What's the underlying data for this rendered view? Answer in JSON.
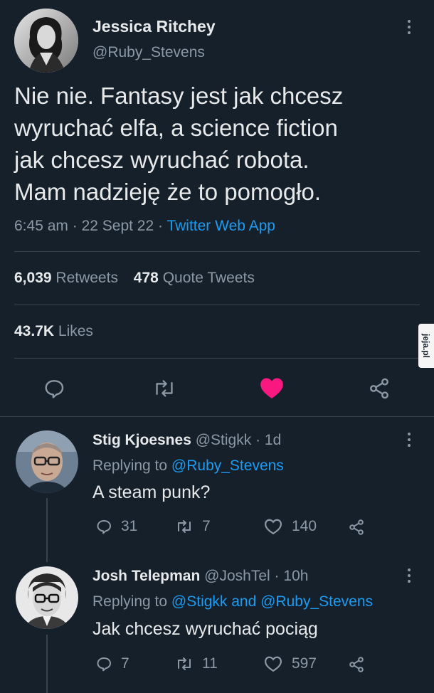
{
  "tweet": {
    "author_name": "Jessica Ritchey",
    "author_handle": "@Ruby_Stevens",
    "text_lines": [
      "Nie nie. Fantasy jest jak chcesz",
      "wyruchać elfa, a science fiction",
      "jak chcesz wyruchać robota.",
      "Mam nadzieję że to pomogło."
    ],
    "time": "6:45 am",
    "date": "22 Sept 22",
    "source": "Twitter Web App",
    "retweets_count": "6,039",
    "retweets_label": "Retweets",
    "quotes_count": "478",
    "quotes_label": "Quote Tweets",
    "likes_count": "43.7K",
    "likes_label": "Likes"
  },
  "replies": [
    {
      "name": "Stig Kjoesnes",
      "handle": "@Stigkk",
      "age": "1d",
      "replying_prefix": "Replying to",
      "replying_to": "@Ruby_Stevens",
      "text": "A steam punk?",
      "reply_count": "31",
      "retweet_count": "7",
      "like_count": "140"
    },
    {
      "name": "Josh Telepman",
      "handle": "@JoshTel",
      "age": "10h",
      "replying_prefix": "Replying to",
      "replying_to": "@Stigkk and @Ruby_Stevens",
      "text": "Jak chcesz wyruchać pociąg",
      "reply_count": "7",
      "retweet_count": "11",
      "like_count": "597"
    }
  ],
  "watermark": "jeja.pl",
  "colors": {
    "background": "#15202b",
    "text": "#e7e9ea",
    "muted": "#8b98a5",
    "link": "#1d9bf0",
    "like_active": "#f91880"
  },
  "icons": [
    "comment-icon",
    "retweet-icon",
    "heart-icon",
    "share-icon",
    "more-icon"
  ]
}
